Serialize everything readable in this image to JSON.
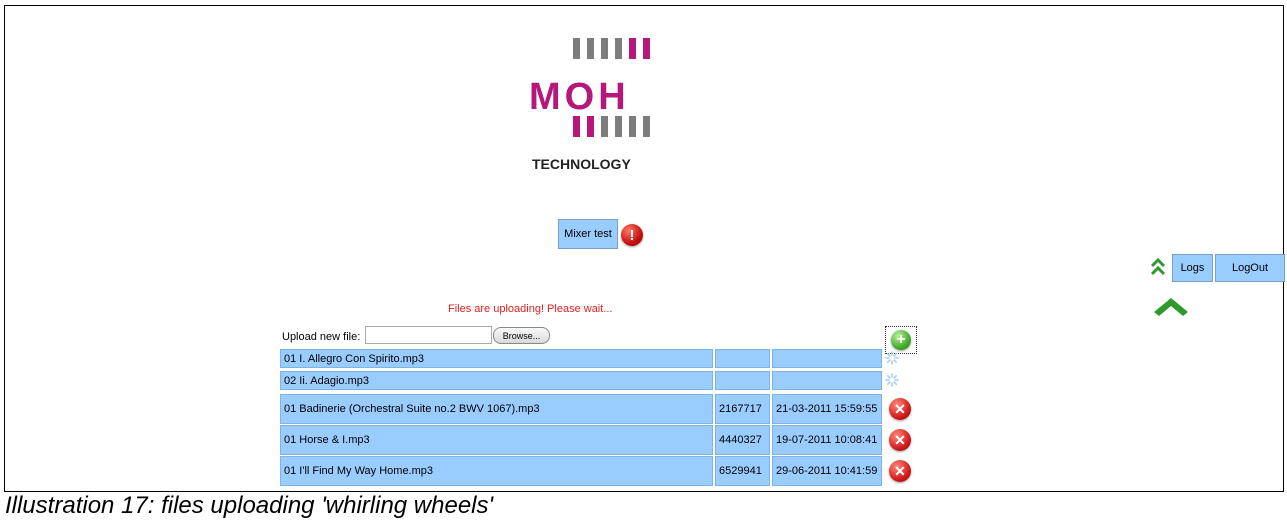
{
  "logo": {
    "brand": "MOH",
    "tagline": "TECHNOLOGY",
    "brand_color": "#b5177b",
    "bar_color": "#7d7d7d"
  },
  "mixer": {
    "label": "Mixer test",
    "alert_icon": "exclamation-icon"
  },
  "nav": {
    "logs_label": "Logs",
    "logout_label": "LogOut",
    "double_chevron_icon": "double-chevron-up-icon",
    "scroll_up_icon": "chevron-up-icon"
  },
  "upload": {
    "status": "Files are uploading! Please wait...",
    "label": "Upload new file:",
    "input_value": "",
    "browse_label": "Browse...",
    "add_icon": "plus-circle-icon"
  },
  "files": [
    {
      "name": "01 I. Allegro Con Spirito.mp3",
      "size": "",
      "date": "",
      "state": "uploading"
    },
    {
      "name": "02 Ii. Adagio.mp3",
      "size": "",
      "date": "",
      "state": "uploading"
    },
    {
      "name": "01 Badinerie (Orchestral Suite no.2 BWV 1067).mp3",
      "size": "2167717",
      "date": "21-03-2011 15:59:55",
      "state": "done"
    },
    {
      "name": "01 Horse & I.mp3",
      "size": "4440327",
      "date": "19-07-2011 10:08:41",
      "state": "done"
    },
    {
      "name": "01 I'll Find My Way Home.mp3",
      "size": "6529941",
      "date": "29-06-2011 10:41:59",
      "state": "done"
    }
  ],
  "caption": "Illustration 17: files uploading 'whirling wheels'",
  "colors": {
    "button_bg": "#99ccff",
    "status_text": "#e02020",
    "delete_icon": "#d31d1d",
    "add_icon": "#3ea526",
    "chevron": "#2e9a2e"
  }
}
